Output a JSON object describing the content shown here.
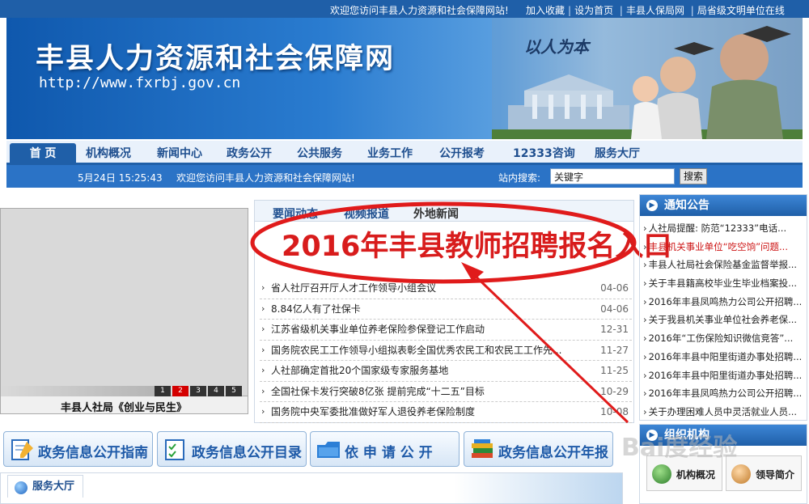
{
  "topbar": {
    "welcome": "欢迎您访问丰县人力资源和社会保障网站!",
    "links": [
      "加入收藏",
      "设为首页",
      "丰县人保局网",
      "局省级文明单位在线"
    ]
  },
  "banner": {
    "title": "丰县人力资源和社会保障网",
    "url": "http://www.fxrbj.gov.cn",
    "slogan": "以人为本"
  },
  "nav": {
    "home": "首 页",
    "items": [
      "机构概况",
      "新闻中心",
      "政务公开",
      "公共服务",
      "业务工作",
      "公开报考",
      "12333咨询",
      "服务大厅"
    ]
  },
  "subbar": {
    "date": "5月24日  15:25:43",
    "message": "欢迎您访问丰县人力资源和社会保障网站!",
    "search_label": "站内搜索:",
    "search_value": "关键字",
    "search_button": "搜索"
  },
  "slideshow": {
    "caption": "丰县人社局《创业与民生》",
    "pages": [
      "1",
      "2",
      "3",
      "4",
      "5"
    ],
    "active_page": "2"
  },
  "news": {
    "tabs": [
      "要闻动态",
      "视频报道",
      "外地新闻"
    ],
    "annotation": "2016年丰县教师招聘报名入口",
    "items": [
      {
        "title": "省人社厅召开厅人才工作领导小组会议",
        "date": "04-06"
      },
      {
        "title": "8.84亿人有了社保卡",
        "date": "04-06"
      },
      {
        "title": "江苏省级机关事业单位养老保险参保登记工作启动",
        "date": "12-31"
      },
      {
        "title": "国务院农民工工作领导小组拟表彰全国优秀农民工和农民工工作先...",
        "date": "11-27"
      },
      {
        "title": "人社部确定首批20个国家级专家服务基地",
        "date": "11-25"
      },
      {
        "title": "全国社保卡发行突破8亿张 提前完成“十二五”目标",
        "date": "10-29"
      },
      {
        "title": "国务院中央军委批准做好军人退役养老保险制度",
        "date": "10-08"
      }
    ]
  },
  "notice": {
    "title": "通知公告",
    "items": [
      {
        "title": "人社局提醒: 防范“12333”电话...",
        "hot": false
      },
      {
        "title": "丰县机关事业单位“吃空饷”问题...",
        "hot": true
      },
      {
        "title": "丰县人社局社会保险基金监督举报...",
        "hot": false
      },
      {
        "title": "关于丰县籍高校毕业生毕业档案投...",
        "hot": false
      },
      {
        "title": "2016年丰县凤鸣热力公司公开招聘...",
        "hot": false
      },
      {
        "title": "关于我县机关事业单位社会养老保...",
        "hot": false
      },
      {
        "title": "2016年“工伤保险知识微信竞答”...",
        "hot": false
      },
      {
        "title": "2016年丰县中阳里街道办事处招聘...",
        "hot": false
      },
      {
        "title": "2016年丰县中阳里街道办事处招聘...",
        "hot": false
      },
      {
        "title": "2016年丰县凤鸣热力公司公开招聘...",
        "hot": false
      },
      {
        "title": "关于办理困难人员中灵活就业人员...",
        "hot": false
      }
    ]
  },
  "org": {
    "title": "组织机构",
    "buttons": [
      "机构概况",
      "领导简介"
    ]
  },
  "quick_links": [
    "政务信息公开指南",
    "政务信息公开目录",
    "依 申 请 公 开",
    "政务信息公开年报"
  ],
  "service": {
    "tab": "服务大厅"
  },
  "watermark": "Bai度经验"
}
